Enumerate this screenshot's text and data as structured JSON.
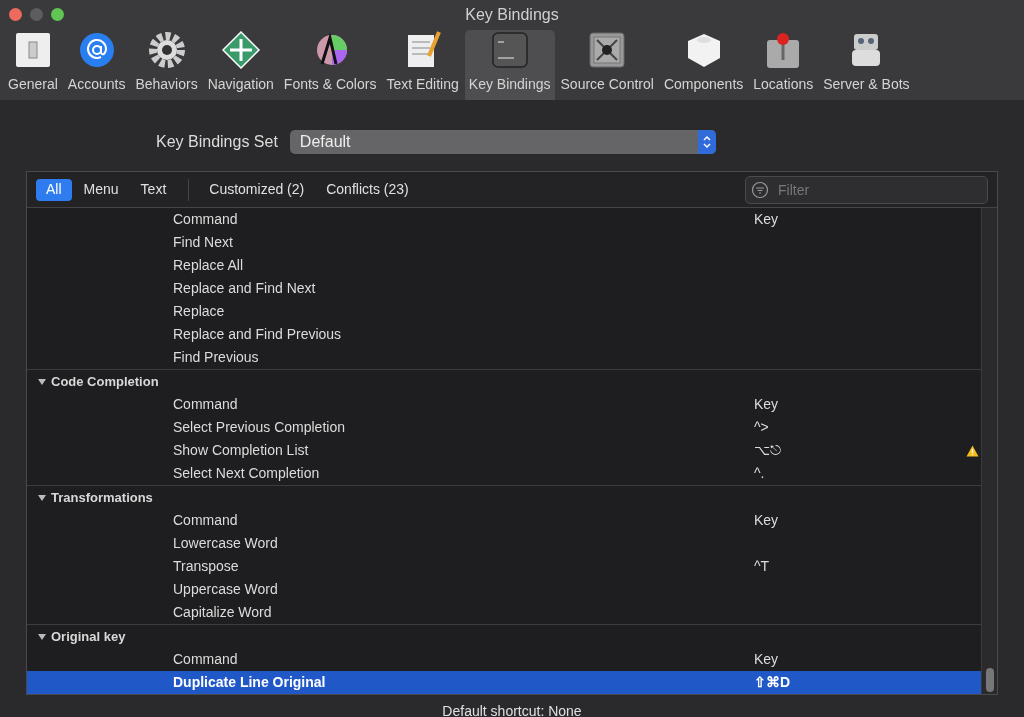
{
  "window": {
    "title": "Key Bindings"
  },
  "toolbar": [
    {
      "label": "General",
      "selected": false
    },
    {
      "label": "Accounts",
      "selected": false
    },
    {
      "label": "Behaviors",
      "selected": false
    },
    {
      "label": "Navigation",
      "selected": false
    },
    {
      "label": "Fonts & Colors",
      "selected": false
    },
    {
      "label": "Text Editing",
      "selected": false
    },
    {
      "label": "Key Bindings",
      "selected": true
    },
    {
      "label": "Source Control",
      "selected": false
    },
    {
      "label": "Components",
      "selected": false
    },
    {
      "label": "Locations",
      "selected": false
    },
    {
      "label": "Server & Bots",
      "selected": false
    }
  ],
  "key_bindings_set": {
    "label": "Key Bindings Set",
    "value": "Default"
  },
  "filter_tabs": [
    {
      "label": "All",
      "selected": true
    },
    {
      "label": "Menu",
      "selected": false
    },
    {
      "label": "Text",
      "selected": false
    },
    {
      "label": "Customized (2)",
      "selected": false
    },
    {
      "label": "Conflicts (23)",
      "selected": false
    }
  ],
  "filter": {
    "placeholder": "Filter"
  },
  "groups": [
    {
      "columns": {
        "command": "Command",
        "key": "Key"
      },
      "rows": [
        {
          "command": "Find Next",
          "selected": false,
          "conflict": false
        },
        {
          "command": "Replace All",
          "selected": false,
          "conflict": false
        },
        {
          "command": "Replace and Find Next",
          "selected": false,
          "conflict": false
        },
        {
          "command": "Replace",
          "selected": false,
          "conflict": false
        },
        {
          "command": "Replace and Find Previous",
          "selected": false,
          "conflict": false
        },
        {
          "command": "Find Previous",
          "selected": false,
          "conflict": false
        }
      ]
    },
    {
      "title": "Code Completion",
      "expanded": true,
      "columns": {
        "command": "Command",
        "key": "Key"
      },
      "rows": [
        {
          "command": "Select Previous Completion",
          "key": "^>",
          "selected": false,
          "conflict": false
        },
        {
          "command": "Show Completion List",
          "key": "⌥⎋",
          "selected": false,
          "conflict": true
        },
        {
          "command": "Select Next Completion",
          "key": "^.",
          "selected": false,
          "conflict": false
        }
      ]
    },
    {
      "title": "Transformations",
      "expanded": true,
      "columns": {
        "command": "Command",
        "key": "Key"
      },
      "rows": [
        {
          "command": "Lowercase Word",
          "selected": false,
          "conflict": false
        },
        {
          "command": "Transpose",
          "key": "^T",
          "selected": false,
          "conflict": false
        },
        {
          "command": "Uppercase Word",
          "selected": false,
          "conflict": false
        },
        {
          "command": "Capitalize Word",
          "selected": false,
          "conflict": false
        }
      ]
    },
    {
      "title": "Original key",
      "expanded": true,
      "columns": {
        "command": "Command",
        "key": "Key"
      },
      "rows": [
        {
          "command": "Duplicate Line Original",
          "key": "⇧⌘D",
          "selected": true,
          "conflict": false
        }
      ]
    }
  ],
  "status_bar": "Default shortcut: None"
}
